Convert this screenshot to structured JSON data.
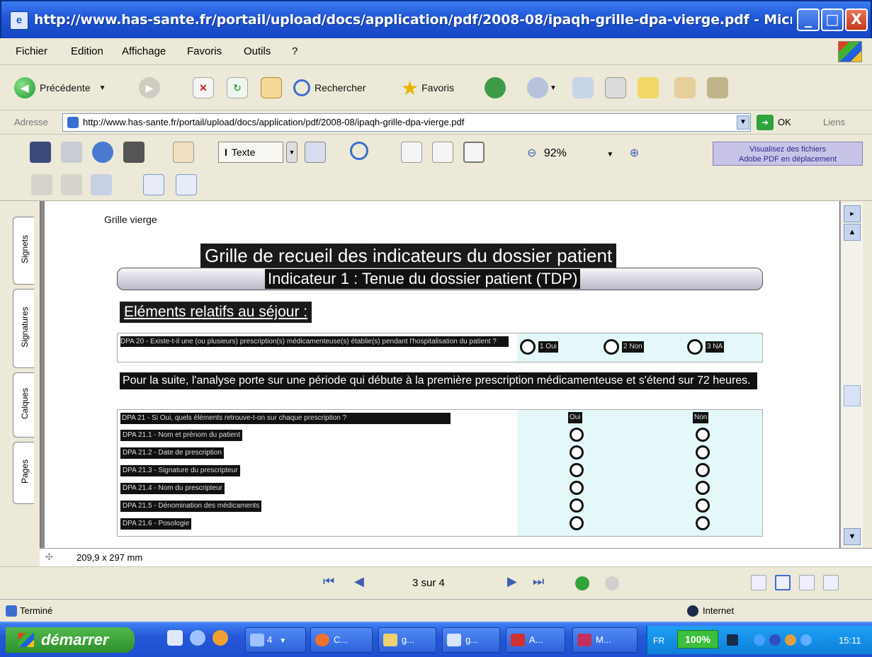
{
  "window": {
    "title": "http://www.has-sante.fr/portail/upload/docs/application/pdf/2008-08/ipaqh-grille-dpa-vierge.pdf - Microsoft ...",
    "controls": {
      "minimize": "_",
      "maximize": "□",
      "close": "X"
    }
  },
  "menu": [
    "Fichier",
    "Edition",
    "Affichage",
    "Favoris",
    "Outils",
    "?"
  ],
  "toolbar": {
    "back": "Précédente",
    "search": "Rechercher",
    "favorites": "Favoris"
  },
  "address": {
    "label": "Adresse",
    "url": "http://www.has-sante.fr/portail/upload/docs/application/pdf/2008-08/ipaqh-grille-dpa-vierge.pdf",
    "go": "OK",
    "links": "Liens"
  },
  "pdf_toolbar": {
    "text_tool": "Texte",
    "zoom": "92%",
    "promo": [
      "Visualisez des fichiers",
      "Adobe PDF en déplacement"
    ]
  },
  "side_tabs": [
    "Signets",
    "Signatures",
    "Calques",
    "Pages"
  ],
  "document": {
    "header": "Grille vierge",
    "title": "Grille de recueil des indicateurs du dossier patient",
    "indicator": "Indicateur 1 : Tenue du dossier patient (TDP)",
    "section": "Eléments relatifs au séjour :",
    "q20": {
      "text": "DPA 20 - Existe-t-il une (ou plusieurs) prescription(s) médicamenteuse(s) établie(s) pendant l'hospitalisation du patient ?",
      "options": [
        "1 Oui",
        "2 Non",
        "3 NA"
      ]
    },
    "note": "Pour la suite, l'analyse porte sur une période qui débute à la première prescription médicamenteuse et s'étend sur 72 heures.",
    "q21": {
      "header": "DPA 21 - Si Oui, quels éléments retrouve-t-on sur chaque prescription ?",
      "col_yes": "Oui",
      "col_no": "Non",
      "rows": [
        "DPA 21.1 - Nom et prénom du patient",
        "DPA 21.2 - Date de prescription",
        "DPA 21.3 - Signature du prescripteur",
        "DPA 21.4 - Nom du prescripteur",
        "DPA 21.5 - Dénomination des médicaments",
        "DPA 21.6 - Posologie"
      ]
    }
  },
  "page_size": "209,9 x 297 mm",
  "navigation": {
    "page": "3 sur 4"
  },
  "status": {
    "done": "Terminé",
    "zone": "Internet"
  },
  "taskbar": {
    "start": "démarrer",
    "group_count": "4",
    "tasks": [
      "C...",
      "g...",
      "g...",
      "A...",
      "M..."
    ],
    "lang": "FR",
    "battery": "100%",
    "clock": "15:11"
  }
}
